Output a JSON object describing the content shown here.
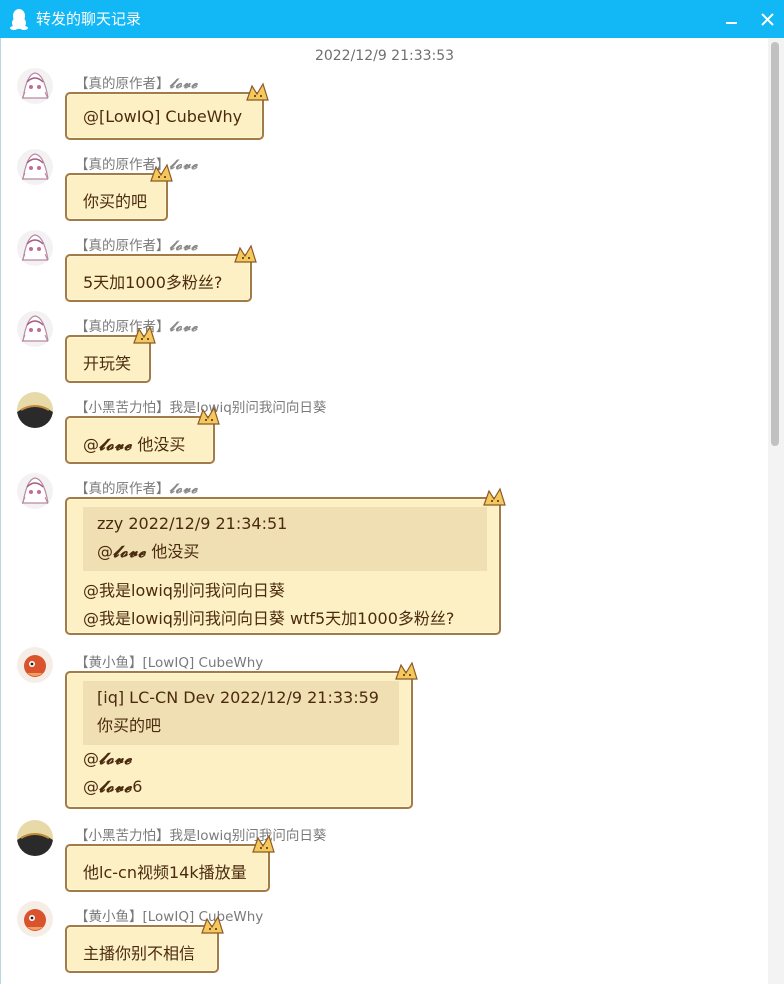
{
  "window": {
    "title": "转发的聊天记录",
    "minimize_icon": "minimize-icon",
    "close_icon": "close-icon"
  },
  "timestamp": "2022/12/9 21:33:53",
  "colors": {
    "titlebar": "#12b7f5",
    "bubble_bg": "#fdf0c4",
    "bubble_border": "#a27b46",
    "quote_bg": "#efdfb2"
  },
  "senders": {
    "s1": {
      "name": "【真的原作者】",
      "nick": "𝓵𝓸𝓿𝓮"
    },
    "s2": {
      "name": "【小黑苦力怕】我是lowiq别问我问向日葵"
    },
    "s3": {
      "name": "【黄小鱼】[LowIQ] CubeWhy"
    }
  },
  "messages": {
    "m1": {
      "text": "@[LowIQ] CubeWhy"
    },
    "m2": {
      "text": "你买的吧"
    },
    "m3": {
      "text": "5天加1000多粉丝?"
    },
    "m4": {
      "text": "开玩笑"
    },
    "m5": {
      "at": "@",
      "nick": "𝓵𝓸𝓿𝓮",
      "rest": " 他没买"
    },
    "m6": {
      "quote": {
        "header": "zzy  2022/12/9 21:34:51",
        "at": "@",
        "nick": "𝓵𝓸𝓿𝓮",
        "rest": " 他没买"
      },
      "line1": "@我是lowiq别问我问向日葵",
      "line2": " @我是lowiq别问我问向日葵 wtf5天加1000多粉丝?"
    },
    "m7": {
      "quote": {
        "header": "[iq] LC-CN Dev  2022/12/9 21:33:59",
        "body": "你买的吧"
      },
      "line1_at": "@",
      "line1_nick": "𝓵𝓸𝓿𝓮",
      "line2_at": " @",
      "line2_nick": "𝓵𝓸𝓿𝓮",
      "line2_rest": "6"
    },
    "m8": {
      "text": "他lc-cn视频14k播放量"
    },
    "m9": {
      "text": "主播你别不相信"
    }
  }
}
